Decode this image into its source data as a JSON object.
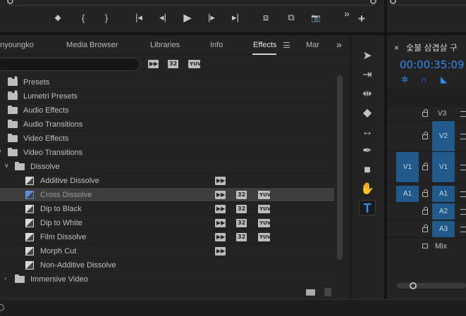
{
  "transport": {
    "marker": "⬥",
    "mark_in": "{",
    "mark_out": "}",
    "go_to_in": "|◂",
    "step_back": "◂|",
    "play": "▶",
    "step_forward": "|▸",
    "go_to_out": "▸|",
    "insert": "⧈",
    "overwrite": "⧉",
    "export_frame": "📷",
    "more": "»",
    "add": "+"
  },
  "effects_panel": {
    "tabs": [
      {
        "label": "unyoungko"
      },
      {
        "label": "Media Browser"
      },
      {
        "label": "Libraries"
      },
      {
        "label": "Info"
      },
      {
        "label": "Effects"
      },
      {
        "label": "Mar"
      }
    ],
    "more_tabs": "»",
    "search": {
      "value": "",
      "placeholder": ""
    },
    "filter_badges": {
      "accelerated": "▶▶",
      "bit32": "32",
      "yuv": "YUV"
    },
    "tree": [
      {
        "label": "Presets",
        "kind": "folder-star",
        "level": 0,
        "chevron": "",
        "badges": ""
      },
      {
        "label": "Lumetri Presets",
        "kind": "folder-star",
        "level": 0,
        "chevron": "",
        "badges": ""
      },
      {
        "label": "Audio Effects",
        "kind": "folder",
        "level": 0,
        "chevron": "",
        "badges": ""
      },
      {
        "label": "Audio Transitions",
        "kind": "folder",
        "level": 0,
        "chevron": "",
        "badges": ""
      },
      {
        "label": "Video Effects",
        "kind": "folder",
        "level": 0,
        "chevron": "",
        "badges": ""
      },
      {
        "label": "Video Transitions",
        "kind": "folder",
        "level": 0,
        "chevron": "∨",
        "badges": ""
      },
      {
        "label": "Dissolve",
        "kind": "folder",
        "level": 1,
        "chevron": "∨",
        "badges": ""
      },
      {
        "label": "Additive Dissolve",
        "kind": "effect",
        "level": 2,
        "chevron": "",
        "badges": "A"
      },
      {
        "label": "Cross Dissolve",
        "kind": "effect",
        "level": 2,
        "chevron": "",
        "badges": "A32Y",
        "selected": true
      },
      {
        "label": "Dip to Black",
        "kind": "effect",
        "level": 2,
        "chevron": "",
        "badges": "A32Y"
      },
      {
        "label": "Dip to White",
        "kind": "effect",
        "level": 2,
        "chevron": "",
        "badges": "A32Y"
      },
      {
        "label": "Film Dissolve",
        "kind": "effect",
        "level": 2,
        "chevron": "",
        "badges": "A32Y"
      },
      {
        "label": "Morph Cut",
        "kind": "effect",
        "level": 2,
        "chevron": "",
        "badges": "A"
      },
      {
        "label": "Non-Additive Dissolve",
        "kind": "effect",
        "level": 2,
        "chevron": "",
        "badges": ""
      },
      {
        "label": "Immersive Video",
        "kind": "folder",
        "level": 1,
        "chevron": "›",
        "badges": ""
      }
    ]
  },
  "tools": [
    {
      "name": "selection-tool",
      "glyph": "➤"
    },
    {
      "name": "track-select-tool",
      "glyph": "⇥"
    },
    {
      "name": "ripple-edit-tool",
      "glyph": "⇹"
    },
    {
      "name": "razor-tool",
      "glyph": "◆"
    },
    {
      "name": "slip-tool",
      "glyph": "↔"
    },
    {
      "name": "pen-tool",
      "glyph": "✒"
    },
    {
      "name": "rectangle-tool",
      "glyph": "■"
    },
    {
      "name": "hand-tool",
      "glyph": "✋"
    },
    {
      "name": "type-tool",
      "glyph": "T",
      "active": true
    }
  ],
  "timeline": {
    "close": "×",
    "sequence_name": "숯불 삼겹살 구",
    "timecode": "00:00:35:09",
    "toolbar_icons": [
      "✲",
      "∩",
      "◣"
    ],
    "tracks": [
      {
        "label": "V3",
        "source": "",
        "target": false
      },
      {
        "label": "V2",
        "source": "",
        "target": true
      },
      {
        "label": "V1",
        "source": "V1",
        "target": true
      },
      {
        "label": "A1",
        "source": "A1",
        "target": true
      },
      {
        "label": "A2",
        "source": "",
        "target": true
      },
      {
        "label": "A3",
        "source": "",
        "target": true
      }
    ],
    "mix_label": "Mix"
  },
  "colors": {
    "accent_blue": "#2e8df5",
    "track_target": "#1f5a8b",
    "panel_bg": "#232323",
    "selected_row": "#3e3e3e"
  }
}
